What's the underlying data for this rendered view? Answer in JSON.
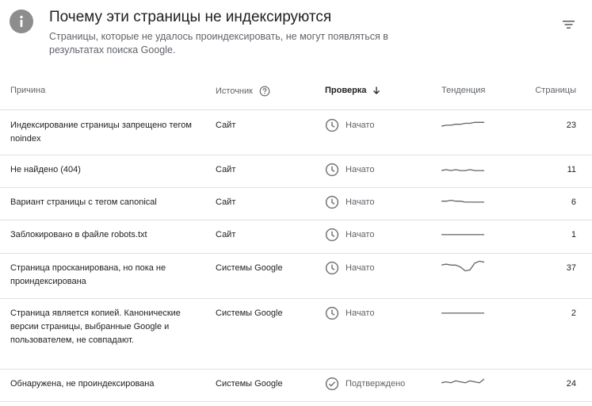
{
  "header": {
    "title": "Почему эти страницы не индексируются",
    "subtitle": "Страницы, которые не удалось проиндексировать, не могут появляться в результатах поиска Google.",
    "info_icon": "info-icon",
    "filter_icon": "filter-icon"
  },
  "columns": {
    "reason": "Причина",
    "source": "Источник",
    "validation": "Проверка",
    "trend": "Тенденция",
    "pages": "Страницы"
  },
  "rows": [
    {
      "reason": "Индексирование страницы запрещено тегом noindex",
      "source": "Сайт",
      "status": "Начато",
      "status_icon": "clock-icon",
      "pages": "23",
      "trend": [
        2,
        2.5,
        2.5,
        3,
        3,
        3.5,
        3.5,
        4,
        4,
        4
      ]
    },
    {
      "reason": "Не найдено (404)",
      "source": "Сайт",
      "status": "Начато",
      "status_icon": "clock-icon",
      "pages": "11",
      "trend": [
        2,
        2.5,
        2,
        2.5,
        2,
        2,
        2.5,
        2,
        2,
        2
      ]
    },
    {
      "reason": "Вариант страницы с тегом canonical",
      "source": "Сайт",
      "status": "Начато",
      "status_icon": "clock-icon",
      "pages": "6",
      "trend": [
        3,
        3,
        3.5,
        3,
        3,
        2.5,
        2.5,
        2.5,
        2.5,
        2.5
      ]
    },
    {
      "reason": "Заблокировано в файле robots.txt",
      "source": "Сайт",
      "status": "Начато",
      "status_icon": "clock-icon",
      "pages": "1",
      "trend": [
        2.5,
        2.5,
        2.5,
        2.5,
        2.5,
        2.5,
        2.5,
        2.5,
        2.5,
        2.5
      ]
    },
    {
      "reason": "Страница просканирована, но пока не проиндексирована",
      "source": "Системы Google",
      "status": "Начато",
      "status_icon": "clock-icon",
      "pages": "37",
      "trend": [
        4,
        4.5,
        4,
        4,
        3,
        1,
        1.5,
        5,
        6,
        5.5
      ]
    },
    {
      "reason": "Страница является копией. Канонические версии страницы, выбранные Google и пользователем, не совпадают.",
      "source": "Системы Google",
      "status": "Начато",
      "status_icon": "clock-icon",
      "pages": "2",
      "trend": [
        2.5,
        2.5,
        2.5,
        2.5,
        2.5,
        2.5,
        2.5,
        2.5,
        2.5,
        2.5
      ]
    },
    {
      "reason": "Обнаружена, не проиндексирована",
      "source": "Системы Google",
      "status": "Подтверждено",
      "status_icon": "check-circle-icon",
      "pages": "24",
      "trend": [
        3,
        3.5,
        3,
        4,
        3.5,
        3,
        4,
        3.5,
        3,
        5
      ]
    }
  ]
}
